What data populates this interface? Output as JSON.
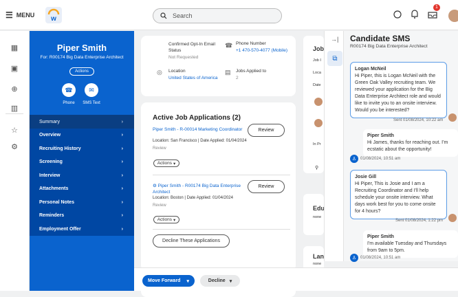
{
  "topbar": {
    "menu_label": "MENU",
    "search_placeholder": "Search",
    "notification_count": "1"
  },
  "candidate": {
    "name": "Piper Smith",
    "for": "For: R00174 Big Data Enterprise Architect",
    "actions_label": "Actions",
    "phone_label": "Phone",
    "sms_label": "SMS Text"
  },
  "nav": {
    "items": [
      {
        "label": "Summary"
      },
      {
        "label": "Overview"
      },
      {
        "label": "Recruiting History"
      },
      {
        "label": "Screening"
      },
      {
        "label": "Interview"
      },
      {
        "label": "Attachments"
      },
      {
        "label": "Personal Notes"
      },
      {
        "label": "Reminders"
      },
      {
        "label": "Employment Offer"
      }
    ]
  },
  "contact": {
    "optin_label": "Confirmed Opt-In Email Status",
    "optin_value": "Not Requested",
    "phone_label": "Phone Number",
    "phone_value": "+1 470-570-4077 (Mobile)",
    "location_label": "Location",
    "location_value": "United States of America",
    "jobs_applied_label": "Jobs Applied to",
    "jobs_applied_value": "2"
  },
  "applications": {
    "title": "Active Job Applications (2)",
    "items": [
      {
        "title": "Piper Smith - R-00014 Marketing Coordinator",
        "meta": "Location: San Francisco | Date Applied: 01/04/2024",
        "status": "Review",
        "review_label": "Review",
        "actions_label": "Actions"
      },
      {
        "title": "Piper Smith - R00174 Big Data Enterprise Architect",
        "meta": "Location: Boston | Date Applied: 01/04/2024",
        "status": "Review",
        "review_label": "Review",
        "actions_label": "Actions"
      }
    ],
    "decline_all_label": "Decline These Applications"
  },
  "side_col": {
    "job_title": "Job",
    "job_sub": "Job I",
    "loc": "Loca",
    "date": "Date",
    "in_pr": "In Pr",
    "edu": "Edu",
    "none1": "none",
    "lan": "Lan",
    "none2": "none"
  },
  "sms": {
    "title": "Candidate SMS",
    "subtitle": "R00174 Big Data Enterprise Architect",
    "messages": [
      {
        "author": "Logan McNeil",
        "text": "Hi Piper, this is Logan McNeil with the Green Oak Valley recruiting team. We reviewed your application for the Big Data Enterprise Architect role and would like to invite you to an onsite interview. Would you be interested?",
        "time": "Sent 01/08/2024, 10:22 am"
      },
      {
        "author": "Piper Smith",
        "text": "Hi James, thanks for reaching out. I'm ecstatic about the opportunity!",
        "time": "01/08/2024, 10:51 am"
      },
      {
        "author": "Josie Gill",
        "text": "Hi Piper, This is Josie and I am a Recruiting Coordinator and I'll help schedule your onsite interview. What days work best for you to come onsite for 4 hours?",
        "time": "Sent 01/08/2024, 1:22 pm"
      },
      {
        "author": "Piper Smith",
        "text": "I'm available Tuesday and Thursdays from 9am to 5pm.",
        "time": "01/08/2024, 10:51 am"
      }
    ]
  },
  "bottom": {
    "move_forward_label": "Move Forward",
    "decline_label": "Decline"
  },
  "colors": {
    "brand_blue": "#0a63ce",
    "nav_blue": "#0047a3",
    "alert_red": "#e2352c"
  }
}
